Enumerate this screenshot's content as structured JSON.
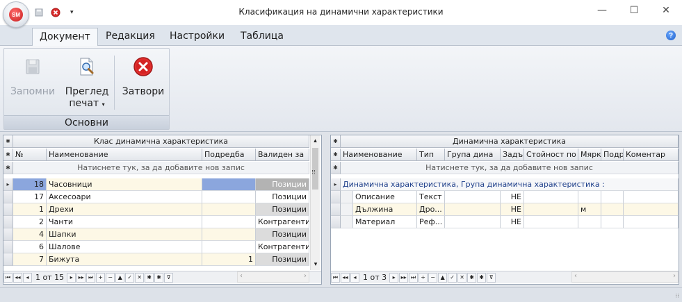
{
  "window": {
    "title": "Класификация на динамични характеристики",
    "app_badge": "SM",
    "controls": {
      "minimize": "—",
      "maximize": "☐",
      "close": "✕"
    },
    "qat_caret": "▾"
  },
  "ribbon": {
    "tabs": [
      "Документ",
      "Редакция",
      "Настройки",
      "Таблица"
    ],
    "active_tab": "Документ",
    "help": "?",
    "group_label": "Основни",
    "buttons": {
      "save": "Запомни",
      "preview_line1": "Преглед",
      "preview_line2": "печат",
      "preview_caret": "▾",
      "close": "Затвори"
    }
  },
  "left_grid": {
    "band_title": "Клас динамична характеристика",
    "columns": [
      "№",
      "Наименование",
      "Подредба",
      "Валиден за"
    ],
    "new_row_text": "Натиснете тук, за да добавите нов запис",
    "rows": [
      {
        "no": "18",
        "name": "Часовници",
        "order": "",
        "valid": "Позиции"
      },
      {
        "no": "17",
        "name": "Аксесоари",
        "order": "",
        "valid": "Позиции"
      },
      {
        "no": "1",
        "name": "Дрехи",
        "order": "",
        "valid": "Позиции"
      },
      {
        "no": "2",
        "name": "Чанти",
        "order": "",
        "valid": "Контрагенти"
      },
      {
        "no": "4",
        "name": "Шапки",
        "order": "",
        "valid": "Позиции"
      },
      {
        "no": "6",
        "name": "Шалове",
        "order": "",
        "valid": "Контрагенти"
      },
      {
        "no": "7",
        "name": "Бижута",
        "order": "1",
        "valid": "Позиции"
      }
    ],
    "pager": "1 от 15"
  },
  "right_grid": {
    "band_title": "Динамична характеристика",
    "columns": [
      "Наименование",
      "Тип",
      "Група дина",
      "Задъ",
      "Стойност по по",
      "Мярк",
      "Подр",
      "Коментар"
    ],
    "new_row_text": "Натиснете тук, за да добавите нов запис",
    "group_row_text": "Динамична характеристика, Група динамична характеристика :",
    "rows": [
      {
        "name": "Описание",
        "type": "Текст",
        "group": "",
        "req": "НЕ",
        "def": "",
        "unit": "",
        "ord": "",
        "comment": ""
      },
      {
        "name": "Дължина",
        "type": "Дро...",
        "group": "",
        "req": "НЕ",
        "def": "",
        "unit": "м",
        "ord": "",
        "comment": ""
      },
      {
        "name": "Материал",
        "type": "Реф...",
        "group": "",
        "req": "НЕ",
        "def": "",
        "unit": "",
        "ord": "",
        "comment": ""
      }
    ],
    "pager": "1 от 3"
  },
  "navigator_glyphs": {
    "first": "⏮",
    "prev_page": "◂◂",
    "prev": "◂",
    "next": "▸",
    "next_page": "▸▸",
    "last": "⏭",
    "insert": "+",
    "delete": "−",
    "edit": "▲",
    "post": "✓",
    "cancel": "✕",
    "refresh": "✱",
    "bookmark": "✱",
    "filter": "⊽"
  },
  "icons": {
    "indicator": "▸",
    "asterisk": "✱",
    "scroll_up": "▴",
    "scroll_down": "▾",
    "scroll_left": "‹",
    "scroll_right": "›",
    "splitter": "⁝⁝"
  },
  "colors": {
    "selected_row": "#8ba6dd",
    "even_row": "#fdf8e6",
    "gray_cell": "#dcdcdc",
    "accent": "#1e3f8a"
  }
}
